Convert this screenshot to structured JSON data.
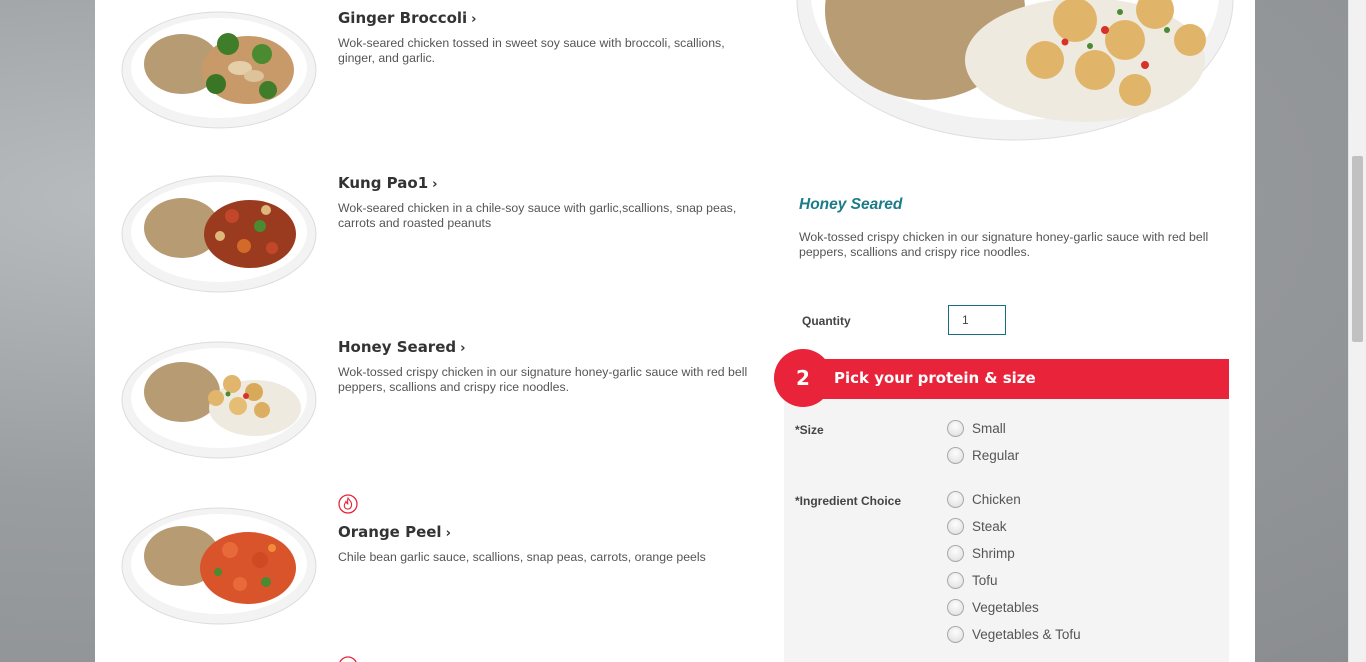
{
  "menu_items": [
    {
      "name": "Ginger Broccoli",
      "description": "Wok-seared chicken tossed in sweet soy sauce with broccoli, scallions, ginger, and garlic.",
      "spicy": false
    },
    {
      "name": "Kung Pao",
      "suffix": "1",
      "description": "Wok-seared chicken in a chile-soy sauce with garlic,scallions, snap peas, carrots and roasted peanuts",
      "spicy": false
    },
    {
      "name": "Honey Seared",
      "description": "Wok-tossed crispy chicken in our signature honey-garlic sauce with red bell peppers, scallions and crispy rice noodles.",
      "spicy": false
    },
    {
      "name": "Orange Peel",
      "description": "Chile bean garlic sauce, scallions, snap peas, carrots, orange peels",
      "spicy": true
    }
  ],
  "chevron": "›",
  "detail": {
    "title": "Honey Seared",
    "description": "Wok-tossed crispy chicken in our signature honey-garlic sauce with red bell peppers, scallions and crispy rice noodles.",
    "quantity_label": "Quantity",
    "quantity_value": "1"
  },
  "step": {
    "number": "2",
    "title": "Pick your protein & size"
  },
  "size_group": {
    "label": "*Size",
    "options": [
      "Small",
      "Regular"
    ]
  },
  "ingredient_group": {
    "label": "*Ingredient Choice",
    "options": [
      "Chicken",
      "Steak",
      "Shrimp",
      "Tofu",
      "Vegetables",
      "Vegetables & Tofu"
    ]
  },
  "colors": {
    "accent_red": "#e8233a",
    "title_teal": "#1a7c87"
  },
  "icons": {
    "spicy": "flame-icon",
    "chevron": "chevron-right-icon"
  }
}
